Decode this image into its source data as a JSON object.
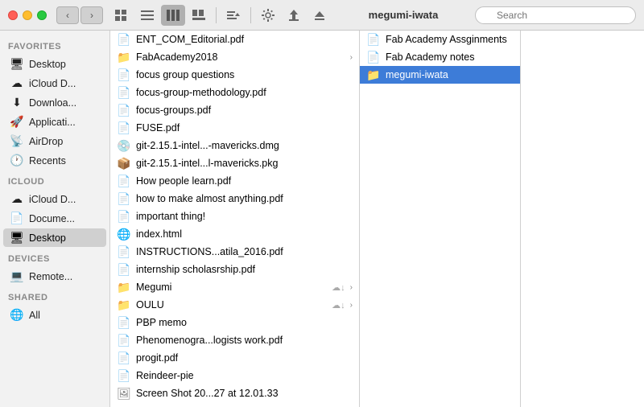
{
  "titleBar": {
    "title": "megumi-iwata",
    "navBack": "‹",
    "navForward": "›",
    "searchPlaceholder": "Search"
  },
  "toolbar": {
    "iconView": "⊞",
    "listView": "☰",
    "columnView": "▦",
    "coverflow": "⊟",
    "arrange": "⊞",
    "action": "⚙",
    "share": "⬆",
    "eject": "⏏"
  },
  "sidebar": {
    "sections": [
      {
        "label": "Favorites",
        "items": [
          {
            "id": "desktop",
            "icon": "🖥",
            "label": "Desktop"
          },
          {
            "id": "icloud-drive",
            "icon": "☁",
            "label": "iCloud D..."
          },
          {
            "id": "downloads",
            "icon": "⬇",
            "label": "Downloa..."
          },
          {
            "id": "applications",
            "icon": "🚀",
            "label": "Applicati..."
          },
          {
            "id": "airdrop",
            "icon": "📡",
            "label": "AirDrop"
          },
          {
            "id": "recents",
            "icon": "🕐",
            "label": "Recents"
          }
        ]
      },
      {
        "label": "iCloud",
        "items": [
          {
            "id": "icloud-drive2",
            "icon": "☁",
            "label": "iCloud D..."
          },
          {
            "id": "documents",
            "icon": "📄",
            "label": "Docume..."
          },
          {
            "id": "desktop2",
            "icon": "🖥",
            "label": "Desktop",
            "active": true
          }
        ]
      },
      {
        "label": "Devices",
        "items": [
          {
            "id": "remote",
            "icon": "💻",
            "label": "Remote..."
          }
        ]
      },
      {
        "label": "Shared",
        "items": [
          {
            "id": "all",
            "icon": "🌐",
            "label": "All"
          }
        ]
      }
    ]
  },
  "panels": {
    "left": {
      "files": [
        {
          "id": "ent-com",
          "icon": "📄",
          "iconClass": "icon-pdf",
          "name": "ENT_COM_Editorial.pdf",
          "type": "pdf"
        },
        {
          "id": "fabacademy2018",
          "icon": "📁",
          "iconClass": "icon-folder",
          "name": "FabAcademy2018",
          "type": "folder",
          "hasArrow": true,
          "selected": false,
          "open": true
        },
        {
          "id": "focus-group-q",
          "icon": "📄",
          "iconClass": "icon-text",
          "name": "focus group questions",
          "type": "file"
        },
        {
          "id": "focus-group-m",
          "icon": "📄",
          "iconClass": "icon-pdf",
          "name": "focus-group-methodology.pdf",
          "type": "pdf"
        },
        {
          "id": "focus-groups",
          "icon": "📄",
          "iconClass": "icon-pdf",
          "name": "focus-groups.pdf",
          "type": "pdf"
        },
        {
          "id": "fuse",
          "icon": "📄",
          "iconClass": "icon-pdf",
          "name": "FUSE.pdf",
          "type": "pdf"
        },
        {
          "id": "git-dmg",
          "icon": "💿",
          "iconClass": "icon-dmg",
          "name": "git-2.15.1-intel...-mavericks.dmg",
          "type": "dmg"
        },
        {
          "id": "git-pkg",
          "icon": "📦",
          "iconClass": "icon-pkg",
          "name": "git-2.15.1-intel...l-mavericks.pkg",
          "type": "pkg"
        },
        {
          "id": "how-people",
          "icon": "📄",
          "iconClass": "icon-pdf",
          "name": "How people learn.pdf",
          "type": "pdf"
        },
        {
          "id": "how-to-make",
          "icon": "📄",
          "iconClass": "icon-pdf",
          "name": "how to make almost anything.pdf",
          "type": "pdf"
        },
        {
          "id": "important",
          "icon": "📄",
          "iconClass": "icon-text",
          "name": "important thing!",
          "type": "file"
        },
        {
          "id": "index-html",
          "icon": "🌐",
          "iconClass": "icon-html",
          "name": "index.html",
          "type": "html"
        },
        {
          "id": "instructions",
          "icon": "📄",
          "iconClass": "icon-pdf",
          "name": "INSTRUCTIONS...atila_2016.pdf",
          "type": "pdf"
        },
        {
          "id": "internship",
          "icon": "📄",
          "iconClass": "icon-pdf",
          "name": "internship scholasrship.pdf",
          "type": "pdf"
        },
        {
          "id": "megumi",
          "icon": "📁",
          "iconClass": "icon-folder",
          "name": "Megumi",
          "type": "folder",
          "hasArrow": true,
          "hasCloud": true
        },
        {
          "id": "oulu",
          "icon": "📁",
          "iconClass": "icon-folder",
          "name": "OULU",
          "type": "folder",
          "hasArrow": true,
          "hasCloud": true
        },
        {
          "id": "pbp-memo",
          "icon": "📄",
          "iconClass": "icon-text",
          "name": "PBP memo",
          "type": "file"
        },
        {
          "id": "phenomeno",
          "icon": "📄",
          "iconClass": "icon-pdf",
          "name": "Phenomenogra...logists work.pdf",
          "type": "pdf"
        },
        {
          "id": "progit",
          "icon": "📄",
          "iconClass": "icon-pdf",
          "name": "progit.pdf",
          "type": "pdf"
        },
        {
          "id": "reindeer-pie",
          "icon": "📄",
          "iconClass": "icon-word",
          "name": "Reindeer-pie",
          "type": "doc"
        },
        {
          "id": "screenshot",
          "icon": "🖼",
          "iconClass": "icon-img",
          "name": "Screen Shot 20...27 at 12.01.33",
          "type": "img"
        }
      ]
    },
    "middle": {
      "files": [
        {
          "id": "fab-assignments",
          "icon": "📄",
          "iconClass": "icon-text",
          "name": "Fab Academy Assginments",
          "type": "file"
        },
        {
          "id": "fab-notes",
          "icon": "📄",
          "iconClass": "icon-text",
          "name": "Fab Academy notes",
          "type": "file"
        },
        {
          "id": "megumi-iwata",
          "icon": "📁",
          "iconClass": "icon-folder-blue",
          "name": "megumi-iwata",
          "type": "folder",
          "selected": true
        }
      ]
    },
    "right": {
      "files": []
    }
  }
}
